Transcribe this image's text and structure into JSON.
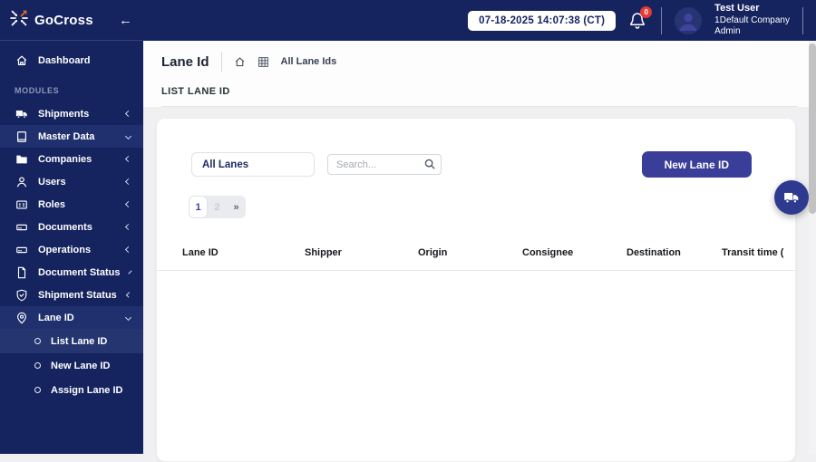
{
  "app": {
    "brand": "GoCross"
  },
  "topbar": {
    "datetime": "07-18-2025 14:07:38 (CT)",
    "notification_count": "0",
    "user": {
      "name": "Test User",
      "company": "1Default Company",
      "role": "Admin"
    }
  },
  "sidebar": {
    "dashboard_label": "Dashboard",
    "section_label": "MODULES",
    "items": [
      {
        "label": "Shipments",
        "state": "collapsed"
      },
      {
        "label": "Master Data",
        "state": "expanded"
      },
      {
        "label": "Companies",
        "state": "collapsed"
      },
      {
        "label": "Users",
        "state": "collapsed"
      },
      {
        "label": "Roles",
        "state": "collapsed"
      },
      {
        "label": "Documents",
        "state": "collapsed"
      },
      {
        "label": "Operations",
        "state": "collapsed"
      },
      {
        "label": "Document Status",
        "state": "collapsed"
      },
      {
        "label": "Shipment Status",
        "state": "collapsed"
      },
      {
        "label": "Lane ID",
        "state": "expanded"
      }
    ],
    "subitems": [
      {
        "label": "List Lane ID",
        "active": true
      },
      {
        "label": "New Lane ID",
        "active": false
      },
      {
        "label": "Assign Lane ID",
        "active": false
      }
    ]
  },
  "page": {
    "title": "Lane Id",
    "breadcrumb": "All Lane Ids",
    "section_title": "LIST LANE ID"
  },
  "toolbar": {
    "filter_value": "All Lanes",
    "search_placeholder": "Search...",
    "new_button_label": "New Lane ID"
  },
  "pagination": {
    "page1": "1",
    "page2": "2",
    "next": "»"
  },
  "table": {
    "columns": [
      "Lane ID",
      "Shipper",
      "Origin",
      "Consignee",
      "Destination",
      "Transit time ("
    ]
  },
  "colors": {
    "sidebar_navy": "#15235e",
    "highlight_navy": "#20306e",
    "button_indigo": "#3b3e99",
    "brand_orange": "#e2662c",
    "badge_red": "#e53935"
  }
}
